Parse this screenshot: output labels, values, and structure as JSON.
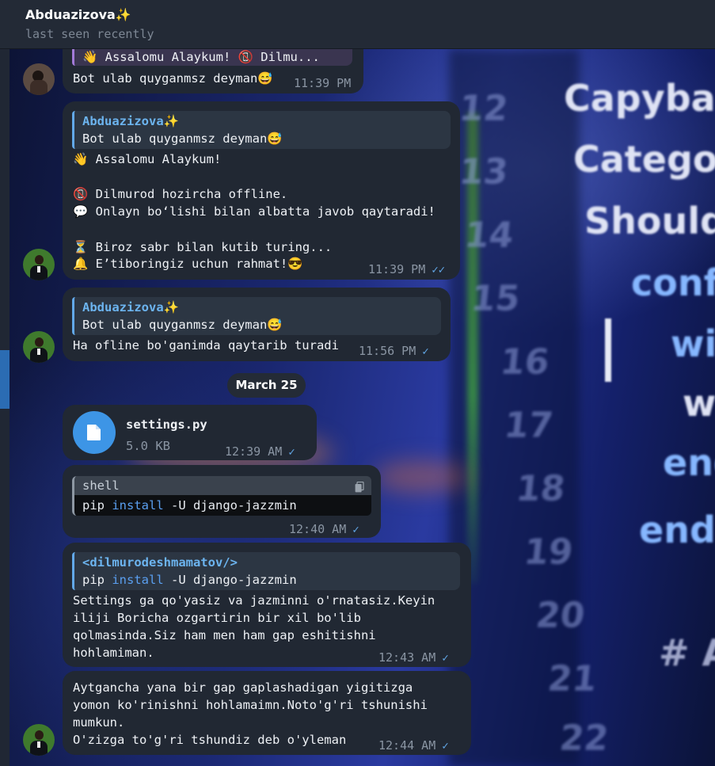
{
  "header": {
    "name": "Abduazizova✨",
    "status": "last seen recently"
  },
  "messages": {
    "m1": {
      "reply_text": "👋 Assalomu Alaykum!  📵 Dilmu...",
      "text": "Bot ulab quyganmsz deyman😅",
      "time": "11:39 PM"
    },
    "m2": {
      "reply_author": "Abduazizova✨",
      "reply_text": "Bot ulab quyganmsz deyman😅",
      "lines": [
        "👋 Assalomu Alaykum!",
        "",
        "📵 Dilmurod hozircha offline.",
        "💬 Onlayn bo‘lishi bilan albatta javob qaytaradi!",
        "",
        "⏳ Biroz sabr bilan kutib turing...",
        "🔔 E’tiboringiz uchun rahmat!😎"
      ],
      "time": "11:39 PM",
      "tick": "✓✓"
    },
    "m3": {
      "reply_author": "Abduazizova✨",
      "reply_text": "Bot ulab quyganmsz deyman😅",
      "text": "Ha ofline bo'ganimda qaytarib turadi",
      "time": "11:56 PM",
      "tick": "✓"
    },
    "date_separator": "March 25",
    "m4": {
      "file_name": "settings.py",
      "file_size": "5.0 KB",
      "time": "12:39 AM",
      "tick": "✓"
    },
    "m5": {
      "code_lang": "shell",
      "code_cmd": "pip",
      "code_kw": "install",
      "code_rest": "-U django-jazzmin",
      "time": "12:40 AM",
      "tick": "✓"
    },
    "m6": {
      "reply_author": "<dilmurodeshmamatov/>",
      "reply_cmd": "pip",
      "reply_kw": "install",
      "reply_rest": "-U django-jazzmin",
      "lines": [
        "Settings ga qo'yasiz va jazminni o'rnatasiz.Keyin",
        "iliji Boricha ozgartirin bir xil bo'lib",
        "qolmasinda.Siz ham men ham gap eshitishni",
        "hohlamiman."
      ],
      "time": "12:43 AM",
      "tick": "✓"
    },
    "m7": {
      "lines": [
        "Aytgancha yana bir gap gaplashadigan yigitizga",
        "yomon ko'rinishni hohlamaimn.Noto'g'ri tshunishi",
        "mumkun.",
        "O'zizga to'g'ri tshundiz deb o'yleman"
      ],
      "time": "12:44 AM",
      "tick": "✓"
    }
  },
  "background_text": {
    "words": [
      "Capybara.",
      "Category",
      "Shoulda:",
      "confi",
      "wi",
      "wi",
      "end",
      "end",
      "# Ac"
    ],
    "line_numbers": [
      "12",
      "13",
      "14",
      "15",
      "16",
      "17",
      "18",
      "19",
      "20",
      "21",
      "22"
    ]
  },
  "colors": {
    "bubble": "#212833",
    "accent": "#62a8e8",
    "header": "#232a36"
  }
}
